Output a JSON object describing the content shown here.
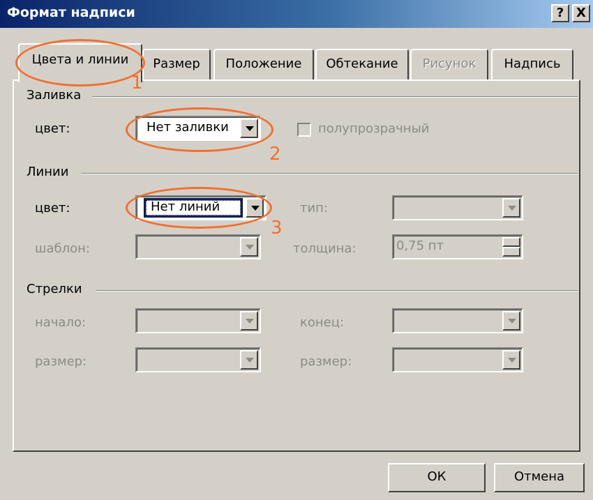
{
  "window": {
    "title": "Формат надписи",
    "help_glyph": "?",
    "close_glyph": "X"
  },
  "tabs": [
    {
      "label": "Цвета и линии",
      "active": true
    },
    {
      "label": "Размер"
    },
    {
      "label": "Положение"
    },
    {
      "label": "Обтекание"
    },
    {
      "label": "Рисунок",
      "disabled": true
    },
    {
      "label": "Надпись"
    }
  ],
  "fill": {
    "group_label": "Заливка",
    "color_label": "цвет:",
    "color_value": "Нет заливки",
    "transparent_label": "полупрозрачный"
  },
  "lines": {
    "group_label": "Линии",
    "color_label": "цвет:",
    "color_value": "Нет линий",
    "type_label": "тип:",
    "pattern_label": "шаблон:",
    "weight_label": "толщина:",
    "weight_value": "0,75 пт"
  },
  "arrows": {
    "group_label": "Стрелки",
    "begin_label": "начало:",
    "end_label": "конец:",
    "begin_size_label": "размер:",
    "end_size_label": "размер:"
  },
  "buttons": {
    "ok": "ОК",
    "cancel": "Отмена"
  },
  "annotations": {
    "n1": "1",
    "n2": "2",
    "n3": "3",
    "color": "#f07030"
  }
}
